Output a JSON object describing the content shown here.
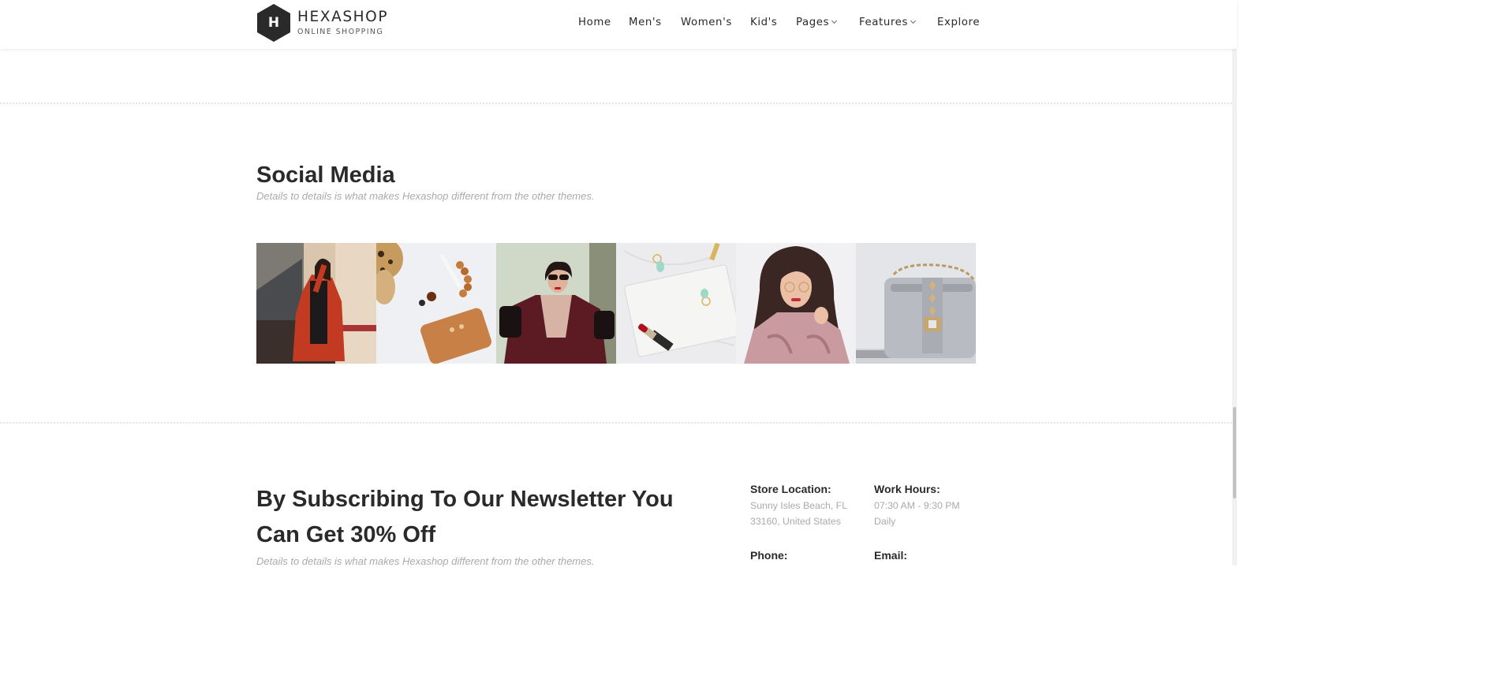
{
  "header": {
    "logo_letter": "H",
    "logo_name": "HEXASHOP",
    "logo_tagline": "ONLINE SHOPPING",
    "nav": [
      {
        "label": "Home",
        "dropdown": false
      },
      {
        "label": "Men's",
        "dropdown": false
      },
      {
        "label": "Women's",
        "dropdown": false
      },
      {
        "label": "Kid's",
        "dropdown": false
      },
      {
        "label": "Pages",
        "dropdown": true
      },
      {
        "label": "Features",
        "dropdown": true
      },
      {
        "label": "Explore",
        "dropdown": false
      }
    ]
  },
  "social": {
    "title": "Social Media",
    "subtitle": "Details to details is what makes Hexashop different from the other themes.",
    "images": [
      {
        "icon": "woman-red-coat-photo"
      },
      {
        "icon": "leather-wallet-accessories-photo"
      },
      {
        "icon": "woman-sunglasses-burgundy-coat-photo"
      },
      {
        "icon": "white-clutch-lipstick-photo"
      },
      {
        "icon": "woman-pink-jacket-photo"
      },
      {
        "icon": "grey-studded-handbag-photo"
      }
    ]
  },
  "newsletter": {
    "title": "By Subscribing To Our Newsletter You Can Get 30% Off",
    "subtitle": "Details to details is what makes Hexashop different from the other themes.",
    "info": {
      "store_label": "Store Location:",
      "store_line1": "Sunny Isles Beach, FL",
      "store_line2": "33160, United States",
      "hours_label": "Work Hours:",
      "hours_line1": "07:30 AM - 9:30 PM",
      "hours_line2": "Daily",
      "phone_label": "Phone:",
      "email_label": "Email:"
    }
  },
  "colors": {
    "text_dark": "#2a2a2a",
    "text_muted": "#aaaaaa",
    "logo_hex": "#2a2a2a",
    "separator": "#e4e4e4"
  }
}
